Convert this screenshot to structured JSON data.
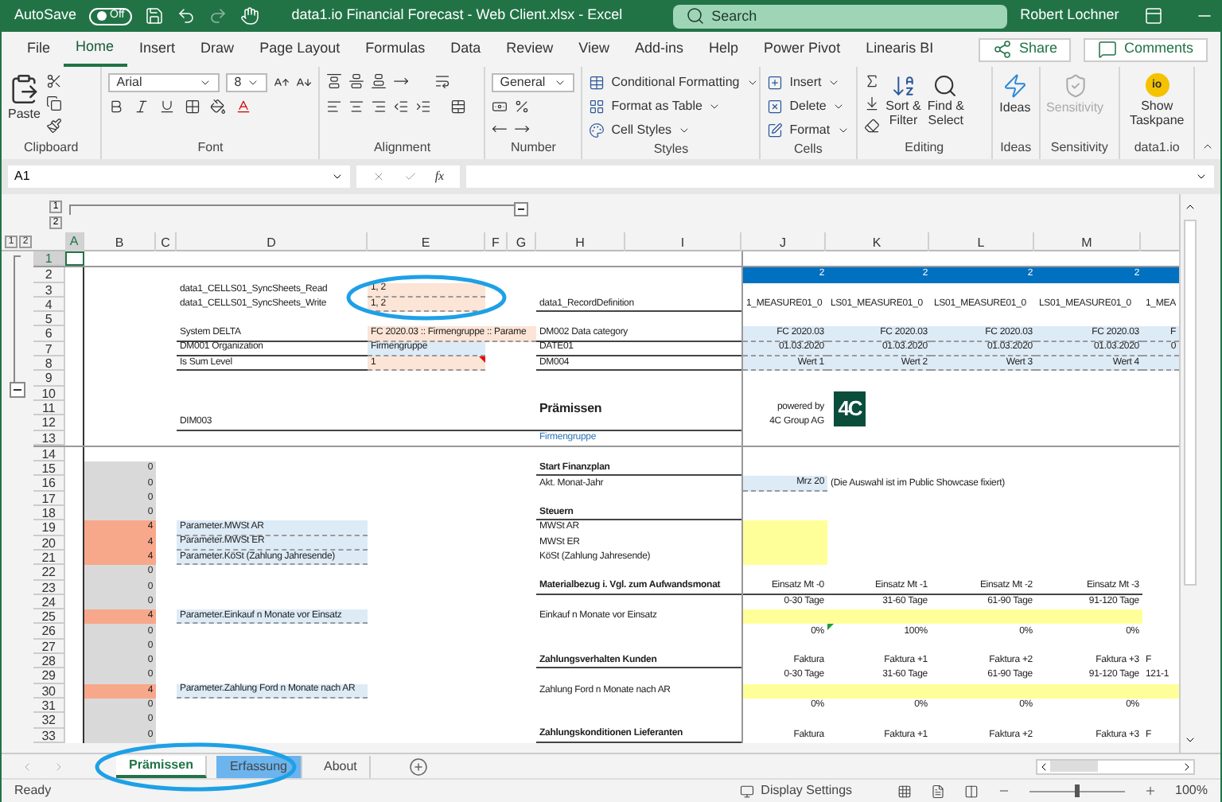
{
  "title_bar": {
    "autosave_label": "AutoSave",
    "autosave_text": "Off",
    "autosave_on": false,
    "title": "data1.io Financial Forecast - Web Client.xlsx  -  Excel",
    "search_placeholder": "Search",
    "user": "Robert Lochner"
  },
  "menu_tabs": [
    {
      "label": "File",
      "selected": false
    },
    {
      "label": "Home",
      "selected": true
    },
    {
      "label": "Insert",
      "selected": false
    },
    {
      "label": "Draw",
      "selected": false
    },
    {
      "label": "Page Layout",
      "selected": false
    },
    {
      "label": "Formulas",
      "selected": false
    },
    {
      "label": "Data",
      "selected": false
    },
    {
      "label": "Review",
      "selected": false
    },
    {
      "label": "View",
      "selected": false
    },
    {
      "label": "Add-ins",
      "selected": false
    },
    {
      "label": "Help",
      "selected": false
    },
    {
      "label": "Power Pivot",
      "selected": false
    },
    {
      "label": "Linearis BI",
      "selected": false
    }
  ],
  "share": "Share",
  "comments": "Comments",
  "ribbon": {
    "clipboard": {
      "label": "Clipboard",
      "paste": "Paste"
    },
    "font": {
      "label": "Font",
      "family": "Arial",
      "size": "8"
    },
    "alignment": {
      "label": "Alignment"
    },
    "number": {
      "label": "Number",
      "format": "General"
    },
    "styles": {
      "label": "Styles",
      "items": [
        "Conditional Formatting",
        "Format as Table",
        "Cell Styles"
      ]
    },
    "cells": {
      "label": "Cells",
      "items": [
        "Insert",
        "Delete",
        "Format"
      ]
    },
    "editing": {
      "label": "Editing",
      "sort": [
        "Sort &",
        "Filter"
      ],
      "find": [
        "Find &",
        "Select"
      ]
    },
    "ideas": {
      "label": "Ideas",
      "button": "Ideas"
    },
    "sensitivity": {
      "label": "Sensitivity",
      "button": "Sensitivity",
      "disabled": true
    },
    "addin": {
      "label": "data1.io",
      "logo": "io",
      "button": [
        "Show",
        "Taskpane"
      ]
    }
  },
  "formula_bar": {
    "name_box": "A1",
    "fx": "fx"
  },
  "column_outline_levels": [
    "1",
    "2"
  ],
  "row_outline_levels": [
    "1",
    "2"
  ],
  "columns": [
    {
      "label": "A",
      "selected": true
    },
    {
      "label": "B",
      "selected": false
    },
    {
      "label": "C",
      "selected": false
    },
    {
      "label": "D",
      "selected": false
    },
    {
      "label": "E",
      "selected": false
    },
    {
      "label": "F",
      "selected": false
    },
    {
      "label": "G",
      "selected": false
    },
    {
      "label": "H",
      "selected": false
    },
    {
      "label": "I",
      "selected": false
    },
    {
      "label": "J",
      "selected": false
    },
    {
      "label": "K",
      "selected": false
    },
    {
      "label": "L",
      "selected": false
    },
    {
      "label": "M",
      "selected": false
    }
  ],
  "rows": [
    {
      "num": "1",
      "selected": true,
      "split": true,
      "cells": {
        "A": {
          "kind": "cursor"
        }
      }
    },
    {
      "num": "2",
      "selected": false,
      "cells": {
        "J": {
          "kind": "band",
          "text": "2"
        },
        "K": {
          "kind": "band",
          "text": "2"
        },
        "L": {
          "kind": "band",
          "text": "2"
        },
        "M": {
          "kind": "band",
          "text": "2"
        },
        "N": {
          "kind": "band"
        }
      }
    },
    {
      "num": "3",
      "selected": false,
      "cells": {
        "D": {
          "kind": "text",
          "text": "data1_CELLS01_SyncSheets_Read"
        },
        "E": {
          "kind": "peach",
          "text": "1, 2",
          "circled": true
        }
      }
    },
    {
      "num": "4",
      "selected": false,
      "cells": {
        "D": {
          "kind": "text",
          "text": "data1_CELLS01_SyncSheets_Write"
        },
        "E": {
          "kind": "peach",
          "text": "1, 2"
        },
        "H": {
          "kind": "rule",
          "text": "data1_RecordDefinition"
        },
        "J": {
          "kind": "text",
          "text": "1_MEASURE01_0"
        },
        "K": {
          "kind": "text",
          "text": "LS01_MEASURE01_0"
        },
        "L": {
          "kind": "text",
          "text": "LS01_MEASURE01_0"
        },
        "M": {
          "kind": "text",
          "text": "LS01_MEASURE01_0"
        },
        "N": {
          "kind": "text",
          "text": "1_MEA"
        }
      }
    },
    {
      "num": "5",
      "selected": false,
      "cells": {}
    },
    {
      "num": "6",
      "selected": false,
      "cells": {
        "D": {
          "kind": "rule",
          "text": "System DELTA"
        },
        "E": {
          "kind": "peach-wide",
          "text": "FC 2020.03 :: Firmengruppe :: Parame"
        },
        "H": {
          "kind": "rule",
          "text": "DM002 Data category"
        },
        "J": {
          "kind": "blue",
          "text": "FC 2020.03"
        },
        "K": {
          "kind": "blue",
          "text": "FC 2020.03"
        },
        "L": {
          "kind": "blue",
          "text": "FC 2020.03"
        },
        "M": {
          "kind": "blue",
          "text": "FC 2020.03"
        },
        "N": {
          "kind": "blue",
          "text": "F"
        }
      }
    },
    {
      "num": "7",
      "selected": false,
      "cells": {
        "D": {
          "kind": "rule",
          "text": "DM001 Organization"
        },
        "E": {
          "kind": "blue-left",
          "text": "Firmengruppe"
        },
        "H": {
          "kind": "rule",
          "text": "DATE01"
        },
        "J": {
          "kind": "blue",
          "text": "01.03.2020"
        },
        "K": {
          "kind": "blue",
          "text": "01.03.2020"
        },
        "L": {
          "kind": "blue",
          "text": "01.03.2020"
        },
        "M": {
          "kind": "blue",
          "text": "01.03.2020"
        },
        "N": {
          "kind": "blue",
          "text": "0"
        }
      }
    },
    {
      "num": "8",
      "selected": false,
      "cells": {
        "D": {
          "kind": "rule",
          "text": "Is Sum Level"
        },
        "E": {
          "kind": "peach",
          "text": "1",
          "comment_marker": true
        },
        "H": {
          "kind": "rule",
          "text": "DM004"
        },
        "J": {
          "kind": "blue",
          "text": "Wert 1"
        },
        "K": {
          "kind": "blue",
          "text": "Wert 2"
        },
        "L": {
          "kind": "blue",
          "text": "Wert 3"
        },
        "M": {
          "kind": "blue",
          "text": "Wert 4"
        },
        "N": {
          "kind": "blue"
        }
      }
    },
    {
      "num": "9",
      "selected": false,
      "cells": {}
    },
    {
      "num": "10",
      "selected": false,
      "cells": {}
    },
    {
      "num": "11",
      "selected": false,
      "cells": {
        "H": {
          "kind": "title",
          "text": "Prämissen"
        },
        "J": {
          "kind": "right",
          "text": "powered by"
        },
        "K": {
          "kind": "logo",
          "text": "4C"
        }
      }
    },
    {
      "num": "12",
      "selected": false,
      "cells": {
        "D": {
          "kind": "rule",
          "text": "DIM003"
        },
        "J": {
          "kind": "right",
          "text": "4C Group AG"
        }
      }
    },
    {
      "num": "13",
      "selected": false,
      "split": true,
      "cells": {
        "H": {
          "kind": "link",
          "text": "Firmengruppe"
        }
      }
    },
    {
      "num": "14",
      "selected": false,
      "cells": {}
    },
    {
      "num": "15",
      "selected": false,
      "cells": {
        "B": {
          "kind": "gray-num",
          "text": "0"
        },
        "H": {
          "kind": "heading",
          "text": "Start Finanzplan"
        }
      }
    },
    {
      "num": "16",
      "selected": false,
      "cells": {
        "B": {
          "kind": "gray-num",
          "text": "0"
        },
        "H": {
          "kind": "text",
          "text": "Akt. Monat-Jahr"
        },
        "J": {
          "kind": "blue",
          "text": "Mrz 20"
        },
        "K": {
          "kind": "text",
          "text": "(Die Auswahl ist im Public Showcase fixiert)"
        }
      }
    },
    {
      "num": "17",
      "selected": false,
      "cells": {
        "B": {
          "kind": "gray-num",
          "text": "0"
        }
      }
    },
    {
      "num": "18",
      "selected": false,
      "cells": {
        "B": {
          "kind": "gray-num",
          "text": "0"
        },
        "H": {
          "kind": "heading",
          "text": "Steuern"
        }
      }
    },
    {
      "num": "19",
      "selected": false,
      "cells": {
        "B": {
          "kind": "flag-num",
          "text": "4"
        },
        "D": {
          "kind": "blue-left",
          "text": "Parameter.MWSt AR"
        },
        "H": {
          "kind": "text",
          "text": "MWSt AR"
        },
        "J": {
          "kind": "yellow"
        }
      }
    },
    {
      "num": "20",
      "selected": false,
      "cells": {
        "B": {
          "kind": "flag-num",
          "text": "4"
        },
        "D": {
          "kind": "blue-left",
          "text": "Parameter.MWSt ER"
        },
        "H": {
          "kind": "text",
          "text": "MWSt ER"
        },
        "J": {
          "kind": "yellow"
        }
      }
    },
    {
      "num": "21",
      "selected": false,
      "cells": {
        "B": {
          "kind": "flag-num",
          "text": "4"
        },
        "D": {
          "kind": "blue-left",
          "text": "Parameter.KöSt (Zahlung Jahresende)"
        },
        "H": {
          "kind": "text",
          "text": "KöSt (Zahlung Jahresende)"
        },
        "J": {
          "kind": "yellow"
        }
      }
    },
    {
      "num": "22",
      "selected": false,
      "cells": {
        "B": {
          "kind": "gray-num",
          "text": "0"
        }
      }
    },
    {
      "num": "23",
      "selected": false,
      "cells": {
        "B": {
          "kind": "gray-num",
          "text": "0"
        },
        "H": {
          "kind": "heading",
          "text": "Materialbezug i. Vgl. zum Aufwandsmonat"
        },
        "J": {
          "kind": "right-rule",
          "text": "Einsatz Mt -0"
        },
        "K": {
          "kind": "right-rule",
          "text": "Einsatz Mt -1"
        },
        "L": {
          "kind": "right-rule",
          "text": "Einsatz Mt -2"
        },
        "M": {
          "kind": "right-rule",
          "text": "Einsatz Mt -3"
        }
      }
    },
    {
      "num": "24",
      "selected": false,
      "cells": {
        "B": {
          "kind": "gray-num",
          "text": "0"
        },
        "J": {
          "kind": "right",
          "text": "0-30 Tage"
        },
        "K": {
          "kind": "right",
          "text": "31-60 Tage"
        },
        "L": {
          "kind": "right",
          "text": "61-90 Tage"
        },
        "M": {
          "kind": "right",
          "text": "91-120 Tage"
        }
      }
    },
    {
      "num": "25",
      "selected": false,
      "cells": {
        "B": {
          "kind": "flag-num",
          "text": "4"
        },
        "D": {
          "kind": "blue-left",
          "text": "Parameter.Einkauf n Monate vor Einsatz"
        },
        "H": {
          "kind": "text",
          "text": "Einkauf n Monate vor Einsatz"
        },
        "J": {
          "kind": "yellow"
        },
        "K": {
          "kind": "yellow"
        },
        "L": {
          "kind": "yellow"
        },
        "M": {
          "kind": "yellow"
        }
      }
    },
    {
      "num": "26",
      "selected": false,
      "cells": {
        "B": {
          "kind": "gray-num",
          "text": "0"
        },
        "J": {
          "kind": "right",
          "text": "0%"
        },
        "K": {
          "kind": "right",
          "text": "100%",
          "error_marker": true
        },
        "L": {
          "kind": "right",
          "text": "0%"
        },
        "M": {
          "kind": "right",
          "text": "0%"
        }
      }
    },
    {
      "num": "27",
      "selected": false,
      "cells": {
        "B": {
          "kind": "gray-num",
          "text": "0"
        }
      }
    },
    {
      "num": "28",
      "selected": false,
      "cells": {
        "B": {
          "kind": "gray-num",
          "text": "0"
        },
        "H": {
          "kind": "heading",
          "text": "Zahlungsverhalten Kunden"
        },
        "J": {
          "kind": "right",
          "text": "Faktura"
        },
        "K": {
          "kind": "right",
          "text": "Faktura +1"
        },
        "L": {
          "kind": "right",
          "text": "Faktura +2"
        },
        "M": {
          "kind": "right",
          "text": "Faktura +3"
        },
        "N": {
          "kind": "text",
          "text": "F"
        }
      }
    },
    {
      "num": "29",
      "selected": false,
      "cells": {
        "B": {
          "kind": "gray-num",
          "text": "0"
        },
        "J": {
          "kind": "right",
          "text": "0-30 Tage"
        },
        "K": {
          "kind": "right",
          "text": "31-60 Tage"
        },
        "L": {
          "kind": "right",
          "text": "61-90 Tage"
        },
        "M": {
          "kind": "right",
          "text": "91-120 Tage"
        },
        "N": {
          "kind": "text",
          "text": "121-1"
        }
      }
    },
    {
      "num": "30",
      "selected": false,
      "cells": {
        "B": {
          "kind": "flag-num",
          "text": "4"
        },
        "D": {
          "kind": "blue-left",
          "text": "Parameter.Zahlung Ford n Monate nach AR"
        },
        "H": {
          "kind": "text",
          "text": "Zahlung Ford n Monate nach AR"
        },
        "J": {
          "kind": "yellow"
        },
        "K": {
          "kind": "yellow"
        },
        "L": {
          "kind": "yellow"
        },
        "M": {
          "kind": "yellow"
        },
        "N": {
          "kind": "yellow"
        }
      }
    },
    {
      "num": "31",
      "selected": false,
      "cells": {
        "B": {
          "kind": "gray-num",
          "text": "0"
        },
        "J": {
          "kind": "right",
          "text": "0%"
        },
        "K": {
          "kind": "right",
          "text": "0%"
        },
        "L": {
          "kind": "right",
          "text": "0%"
        },
        "M": {
          "kind": "right",
          "text": "0%"
        }
      }
    },
    {
      "num": "32",
      "selected": false,
      "cells": {
        "B": {
          "kind": "gray-num",
          "text": "0"
        }
      }
    },
    {
      "num": "33",
      "selected": false,
      "cells": {
        "B": {
          "kind": "gray-num",
          "text": "0"
        },
        "H": {
          "kind": "heading",
          "text": "Zahlungskonditionen Lieferanten"
        },
        "J": {
          "kind": "right",
          "text": "Faktura"
        },
        "K": {
          "kind": "right",
          "text": "Faktura +1"
        },
        "L": {
          "kind": "right",
          "text": "Faktura +2"
        },
        "M": {
          "kind": "right",
          "text": "Faktura +3"
        },
        "N": {
          "kind": "text",
          "text": "F"
        }
      }
    }
  ],
  "sheet_tabs": {
    "circled": true,
    "tabs": [
      {
        "label": "Prämissen",
        "selected": true
      },
      {
        "label": "Erfassung",
        "selected": false,
        "color": "#6cb4ee"
      },
      {
        "label": "About",
        "selected": false
      }
    ]
  },
  "status_bar": {
    "status": "Ready",
    "display_settings": "Display Settings",
    "zoom": {
      "level": 0.5,
      "reading": "100%"
    }
  }
}
